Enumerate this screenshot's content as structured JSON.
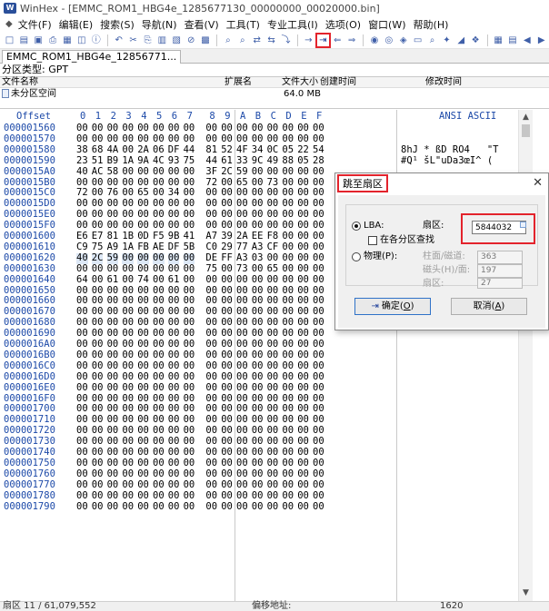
{
  "window": {
    "title": "WinHex - [EMMC_ROM1_HBG4e_1285677130_00000000_00020000.bin]"
  },
  "menu": {
    "items": [
      "文件(F)",
      "编辑(E)",
      "搜索(S)",
      "导航(N)",
      "查看(V)",
      "工具(T)",
      "专业工具(I)",
      "选项(O)",
      "窗口(W)",
      "帮助(H)"
    ]
  },
  "toolbar": {
    "goto_sector_icon": "goto-sector-icon",
    "highlight_color": "#e3232c"
  },
  "doc_tab": {
    "label": "EMMC_ROM1_HBG4e_12856771..."
  },
  "partition": {
    "label": "分区类型: GPT"
  },
  "file_list": {
    "columns": {
      "name": "文件名称",
      "ext": "扩展名",
      "size": "文件大小",
      "created": "创建时间",
      "modified": "修改时间"
    },
    "row": {
      "name": "未分区空间",
      "size": "64.0 MB"
    }
  },
  "hex": {
    "header": {
      "offset": "Offset",
      "cols": [
        "0",
        "1",
        "2",
        "3",
        "4",
        "5",
        "6",
        "7",
        "8",
        "9",
        "A",
        "B",
        "C",
        "D",
        "E",
        "F"
      ],
      "ansi": "ANSI ASCII"
    },
    "rows": [
      {
        "offset": "000001560",
        "bytes": [
          "00",
          "00",
          "00",
          "00",
          "00",
          "00",
          "00",
          "00",
          "00",
          "00",
          "00",
          "00",
          "00",
          "00",
          "00",
          "00"
        ],
        "ansi": ""
      },
      {
        "offset": "000001570",
        "bytes": [
          "00",
          "00",
          "00",
          "00",
          "00",
          "00",
          "00",
          "00",
          "00",
          "00",
          "00",
          "00",
          "00",
          "00",
          "00",
          "00"
        ],
        "ansi": ""
      },
      {
        "offset": "000001580",
        "bytes": [
          "38",
          "68",
          "4A",
          "00",
          "2A",
          "06",
          "DF",
          "44",
          "81",
          "52",
          "4F",
          "34",
          "0C",
          "05",
          "22",
          "54"
        ],
        "ansi": "8hJ * ßD RO4   \"T"
      },
      {
        "offset": "000001590",
        "bytes": [
          "23",
          "51",
          "B9",
          "1A",
          "9A",
          "4C",
          "93",
          "75",
          "44",
          "61",
          "33",
          "9C",
          "49",
          "88",
          "05",
          "28"
        ],
        "ansi": "#Q¹ šL\"uDa3œI^ ("
      },
      {
        "offset": "0000015A0",
        "bytes": [
          "40",
          "AC",
          "58",
          "00",
          "00",
          "00",
          "00",
          "00",
          "3F",
          "2C",
          "59",
          "00",
          "00",
          "00",
          "00",
          "00"
        ],
        "ansi": ""
      },
      {
        "offset": "0000015B0",
        "bytes": [
          "00",
          "00",
          "00",
          "00",
          "00",
          "00",
          "00",
          "00",
          "72",
          "00",
          "65",
          "00",
          "73",
          "00",
          "00",
          "00"
        ],
        "ansi": ""
      },
      {
        "offset": "0000015C0",
        "bytes": [
          "72",
          "00",
          "76",
          "00",
          "65",
          "00",
          "34",
          "00",
          "00",
          "00",
          "00",
          "00",
          "00",
          "00",
          "00",
          "00"
        ],
        "ansi": ""
      },
      {
        "offset": "0000015D0",
        "bytes": [
          "00",
          "00",
          "00",
          "00",
          "00",
          "00",
          "00",
          "00",
          "00",
          "00",
          "00",
          "00",
          "00",
          "00",
          "00",
          "00"
        ],
        "ansi": ""
      },
      {
        "offset": "0000015E0",
        "bytes": [
          "00",
          "00",
          "00",
          "00",
          "00",
          "00",
          "00",
          "00",
          "00",
          "00",
          "00",
          "00",
          "00",
          "00",
          "00",
          "00"
        ],
        "ansi": ""
      },
      {
        "offset": "0000015F0",
        "bytes": [
          "00",
          "00",
          "00",
          "00",
          "00",
          "00",
          "00",
          "00",
          "00",
          "00",
          "00",
          "00",
          "00",
          "00",
          "00",
          "00"
        ],
        "ansi": ""
      },
      {
        "offset": "000001600",
        "bytes": [
          "E6",
          "E7",
          "81",
          "1B",
          "0D",
          "F5",
          "9B",
          "41",
          "A7",
          "39",
          "2A",
          "EE",
          "F8",
          "00",
          "00",
          "00"
        ],
        "ansi": ""
      },
      {
        "offset": "000001610",
        "bytes": [
          "C9",
          "75",
          "A9",
          "1A",
          "FB",
          "AE",
          "DF",
          "5B",
          "C0",
          "29",
          "77",
          "A3",
          "CF",
          "00",
          "00",
          "00"
        ],
        "ansi": ""
      },
      {
        "offset": "000001620",
        "bytes": [
          "40",
          "2C",
          "59",
          "00",
          "00",
          "00",
          "00",
          "00",
          "DE",
          "FF",
          "A3",
          "03",
          "00",
          "00",
          "00",
          "00"
        ],
        "ansi": "",
        "sel_count": 8
      },
      {
        "offset": "000001630",
        "bytes": [
          "00",
          "00",
          "00",
          "00",
          "00",
          "00",
          "00",
          "00",
          "75",
          "00",
          "73",
          "00",
          "65",
          "00",
          "00",
          "00"
        ],
        "ansi": ""
      },
      {
        "offset": "000001640",
        "bytes": [
          "64",
          "00",
          "61",
          "00",
          "74",
          "00",
          "61",
          "00",
          "00",
          "00",
          "00",
          "00",
          "00",
          "00",
          "00",
          "00"
        ],
        "ansi": ""
      },
      {
        "offset": "000001650",
        "bytes": [
          "00",
          "00",
          "00",
          "00",
          "00",
          "00",
          "00",
          "00",
          "00",
          "00",
          "00",
          "00",
          "00",
          "00",
          "00",
          "00"
        ],
        "ansi": ""
      },
      {
        "offset": "000001660",
        "bytes": [
          "00",
          "00",
          "00",
          "00",
          "00",
          "00",
          "00",
          "00",
          "00",
          "00",
          "00",
          "00",
          "00",
          "00",
          "00",
          "00"
        ],
        "ansi": ""
      },
      {
        "offset": "000001670",
        "bytes": [
          "00",
          "00",
          "00",
          "00",
          "00",
          "00",
          "00",
          "00",
          "00",
          "00",
          "00",
          "00",
          "00",
          "00",
          "00",
          "00"
        ],
        "ansi": ""
      },
      {
        "offset": "000001680",
        "bytes": [
          "00",
          "00",
          "00",
          "00",
          "00",
          "00",
          "00",
          "00",
          "00",
          "00",
          "00",
          "00",
          "00",
          "00",
          "00",
          "00"
        ],
        "ansi": ""
      },
      {
        "offset": "000001690",
        "bytes": [
          "00",
          "00",
          "00",
          "00",
          "00",
          "00",
          "00",
          "00",
          "00",
          "00",
          "00",
          "00",
          "00",
          "00",
          "00",
          "00"
        ],
        "ansi": ""
      },
      {
        "offset": "0000016A0",
        "bytes": [
          "00",
          "00",
          "00",
          "00",
          "00",
          "00",
          "00",
          "00",
          "00",
          "00",
          "00",
          "00",
          "00",
          "00",
          "00",
          "00"
        ],
        "ansi": ""
      },
      {
        "offset": "0000016B0",
        "bytes": [
          "00",
          "00",
          "00",
          "00",
          "00",
          "00",
          "00",
          "00",
          "00",
          "00",
          "00",
          "00",
          "00",
          "00",
          "00",
          "00"
        ],
        "ansi": ""
      },
      {
        "offset": "0000016C0",
        "bytes": [
          "00",
          "00",
          "00",
          "00",
          "00",
          "00",
          "00",
          "00",
          "00",
          "00",
          "00",
          "00",
          "00",
          "00",
          "00",
          "00"
        ],
        "ansi": ""
      },
      {
        "offset": "0000016D0",
        "bytes": [
          "00",
          "00",
          "00",
          "00",
          "00",
          "00",
          "00",
          "00",
          "00",
          "00",
          "00",
          "00",
          "00",
          "00",
          "00",
          "00"
        ],
        "ansi": ""
      },
      {
        "offset": "0000016E0",
        "bytes": [
          "00",
          "00",
          "00",
          "00",
          "00",
          "00",
          "00",
          "00",
          "00",
          "00",
          "00",
          "00",
          "00",
          "00",
          "00",
          "00"
        ],
        "ansi": ""
      },
      {
        "offset": "0000016F0",
        "bytes": [
          "00",
          "00",
          "00",
          "00",
          "00",
          "00",
          "00",
          "00",
          "00",
          "00",
          "00",
          "00",
          "00",
          "00",
          "00",
          "00"
        ],
        "ansi": ""
      },
      {
        "offset": "000001700",
        "bytes": [
          "00",
          "00",
          "00",
          "00",
          "00",
          "00",
          "00",
          "00",
          "00",
          "00",
          "00",
          "00",
          "00",
          "00",
          "00",
          "00"
        ],
        "ansi": ""
      },
      {
        "offset": "000001710",
        "bytes": [
          "00",
          "00",
          "00",
          "00",
          "00",
          "00",
          "00",
          "00",
          "00",
          "00",
          "00",
          "00",
          "00",
          "00",
          "00",
          "00"
        ],
        "ansi": ""
      },
      {
        "offset": "000001720",
        "bytes": [
          "00",
          "00",
          "00",
          "00",
          "00",
          "00",
          "00",
          "00",
          "00",
          "00",
          "00",
          "00",
          "00",
          "00",
          "00",
          "00"
        ],
        "ansi": ""
      },
      {
        "offset": "000001730",
        "bytes": [
          "00",
          "00",
          "00",
          "00",
          "00",
          "00",
          "00",
          "00",
          "00",
          "00",
          "00",
          "00",
          "00",
          "00",
          "00",
          "00"
        ],
        "ansi": ""
      },
      {
        "offset": "000001740",
        "bytes": [
          "00",
          "00",
          "00",
          "00",
          "00",
          "00",
          "00",
          "00",
          "00",
          "00",
          "00",
          "00",
          "00",
          "00",
          "00",
          "00"
        ],
        "ansi": ""
      },
      {
        "offset": "000001750",
        "bytes": [
          "00",
          "00",
          "00",
          "00",
          "00",
          "00",
          "00",
          "00",
          "00",
          "00",
          "00",
          "00",
          "00",
          "00",
          "00",
          "00"
        ],
        "ansi": ""
      },
      {
        "offset": "000001760",
        "bytes": [
          "00",
          "00",
          "00",
          "00",
          "00",
          "00",
          "00",
          "00",
          "00",
          "00",
          "00",
          "00",
          "00",
          "00",
          "00",
          "00"
        ],
        "ansi": ""
      },
      {
        "offset": "000001770",
        "bytes": [
          "00",
          "00",
          "00",
          "00",
          "00",
          "00",
          "00",
          "00",
          "00",
          "00",
          "00",
          "00",
          "00",
          "00",
          "00",
          "00"
        ],
        "ansi": ""
      },
      {
        "offset": "000001780",
        "bytes": [
          "00",
          "00",
          "00",
          "00",
          "00",
          "00",
          "00",
          "00",
          "00",
          "00",
          "00",
          "00",
          "00",
          "00",
          "00",
          "00"
        ],
        "ansi": ""
      },
      {
        "offset": "000001790",
        "bytes": [
          "00",
          "00",
          "00",
          "00",
          "00",
          "00",
          "00",
          "00",
          "00",
          "00",
          "00",
          "00",
          "00",
          "00",
          "00",
          "00"
        ],
        "ansi": ""
      }
    ]
  },
  "status": {
    "sector": "扇区 11 / 61,079,552",
    "offset_label": "偏移地址:",
    "value": "1620"
  },
  "dialog": {
    "title": "跳至扇区",
    "lba_label": "LBA:",
    "sector_label": "扇区:",
    "sector_value": "5844032",
    "search_in_partition": "在各分区查找",
    "physical_label": "物理(P):",
    "cylinder_label": "柱面/磁道:",
    "cylinder_value": "363",
    "head_label": "磁头(H)/面:",
    "head_value": "197",
    "phys_sector_label": "扇区:",
    "phys_sector_value": "27",
    "ok_label": "确定(",
    "ok_key": "O",
    "ok_tail": ")",
    "cancel_label": "取消(",
    "cancel_key": "A",
    "cancel_tail": ")"
  }
}
